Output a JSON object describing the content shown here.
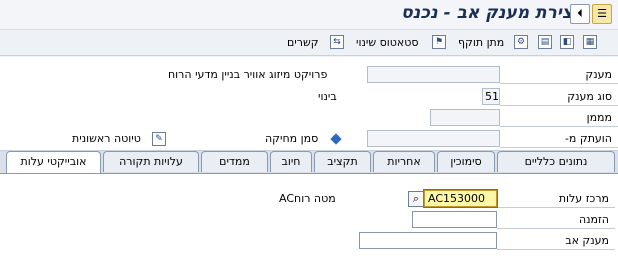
{
  "title": "יצירת מענק אב - נכנס",
  "title_buttons": {
    "menu_icon": "menu-icon",
    "back_icon": "exit-icon"
  },
  "toolbar": {
    "relationships": "קשרים",
    "status_change": "סטאטוס שינוי",
    "grant_period": "מתן תוקף",
    "icons": [
      "grid-icon",
      "navigate-icon",
      "document-icon",
      "status-icon",
      "relation-icon"
    ]
  },
  "header": {
    "grant_label": "מענק",
    "grant_value": "",
    "grant_description": "פרויקט מיזוג אוויר בניין מדעי הרוח",
    "grant_type_label": "סוג מענק",
    "grant_type_value": "51",
    "grant_type_text": "בינוי",
    "funder_label": "מממן",
    "funder_value": "",
    "copied_from_label": "הועתק מ-",
    "copied_from_value": "",
    "delete_flag_label": "סמן מחיקה",
    "draft_label": "טיוטה ראשונית"
  },
  "tabs": [
    {
      "label": "נתונים כלליים",
      "active": false
    },
    {
      "label": "סימוכין",
      "active": false
    },
    {
      "label": "אחריות",
      "active": false
    },
    {
      "label": "תקציב",
      "active": false
    },
    {
      "label": "חיוב",
      "active": false
    },
    {
      "label": "ממדים",
      "active": false
    },
    {
      "label": "עלויות תקורה",
      "active": false
    },
    {
      "label": "אובייקטי עלות",
      "active": true
    }
  ],
  "cost_objects": {
    "cost_center_label": "מרכז עלות",
    "cost_center_value": "AC153000",
    "cost_center_text": "מטה רוחAC",
    "order_label": "הזמנה",
    "order_value": "",
    "parent_grant_label": "מענק אב",
    "parent_grant_value": ""
  },
  "colors": {
    "title": "#1a2f55",
    "focused_field": "#fff7a8",
    "accent": "#2b68c4"
  }
}
